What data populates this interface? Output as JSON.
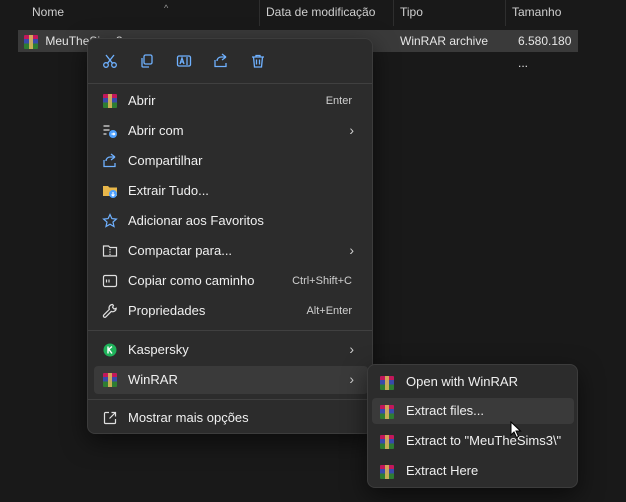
{
  "columns": {
    "name": "Nome",
    "modified": "Data de modificação",
    "type": "Tipo",
    "size": "Tamanho"
  },
  "file": {
    "name": "MeuTheSims3",
    "type": "WinRAR archive",
    "size": "6.580.180 ..."
  },
  "toolbar": [
    "cut-icon",
    "copy-icon",
    "rename-icon",
    "share-icon",
    "delete-icon"
  ],
  "menu": {
    "open": "Abrir",
    "open_shortcut": "Enter",
    "open_with": "Abrir com",
    "share": "Compartilhar",
    "extract_all": "Extrair Tudo...",
    "add_favorites": "Adicionar aos Favoritos",
    "compress_to": "Compactar para...",
    "copy_path": "Copiar como caminho",
    "copy_path_shortcut": "Ctrl+Shift+C",
    "properties": "Propriedades",
    "properties_shortcut": "Alt+Enter",
    "kaspersky": "Kaspersky",
    "winrar": "WinRAR",
    "more_options": "Mostrar mais opções"
  },
  "submenu": {
    "open_with_winrar": "Open with WinRAR",
    "extract_files": "Extract files...",
    "extract_to": "Extract to \"MeuTheSims3\\\"",
    "extract_here": "Extract Here"
  },
  "colors": {
    "menu_bg": "#2c2c2c",
    "hover_bg": "#3a3a3a",
    "accent_blue": "#4ea1ff",
    "kaspersky_green": "#1fb25a"
  }
}
